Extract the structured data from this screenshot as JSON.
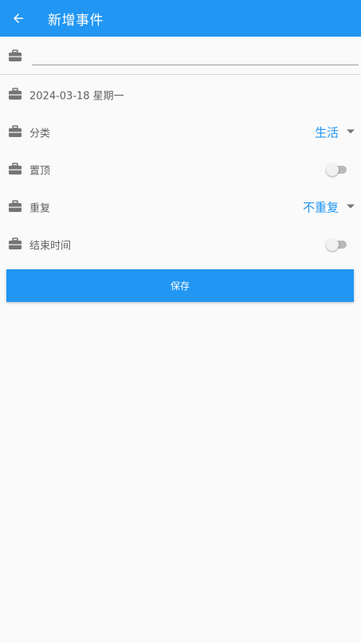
{
  "header": {
    "title": "新增事件",
    "bg_color": "#2196f3"
  },
  "form": {
    "title_input_value": "",
    "date_text": "2024-03-18 星期一",
    "category": {
      "label": "分类",
      "value": "生活"
    },
    "pin": {
      "label": "置顶",
      "enabled": false
    },
    "repeat": {
      "label": "重复",
      "value": "不重复"
    },
    "end_time": {
      "label": "结束时间",
      "enabled": false
    }
  },
  "actions": {
    "save_label": "保存"
  },
  "icons": {
    "back": "arrow-back-icon",
    "row": "briefcase-icon",
    "dropdown": "caret-down-icon"
  }
}
